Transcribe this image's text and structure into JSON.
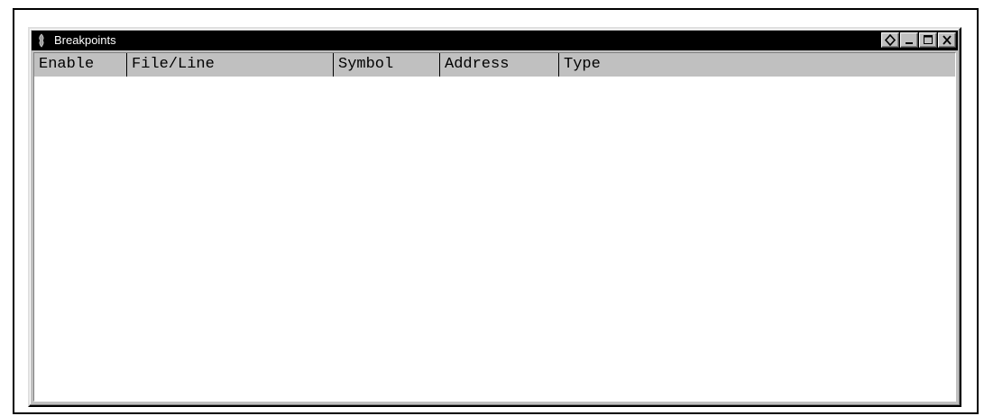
{
  "window": {
    "title": "Breakpoints",
    "buttons": [
      {
        "name": "pin-button",
        "icon": "diamond-icon"
      },
      {
        "name": "minimize-button",
        "icon": "minimize-icon"
      },
      {
        "name": "maximize-button",
        "icon": "maximize-icon"
      },
      {
        "name": "close-button",
        "icon": "close-icon"
      }
    ]
  },
  "table": {
    "columns": [
      "Enable",
      "File/Line",
      "Symbol",
      "Address",
      "Type"
    ],
    "rows": []
  },
  "colors": {
    "titlebar": "#000000",
    "chrome": "#c0c0c0",
    "list_background": "#ffffff"
  }
}
